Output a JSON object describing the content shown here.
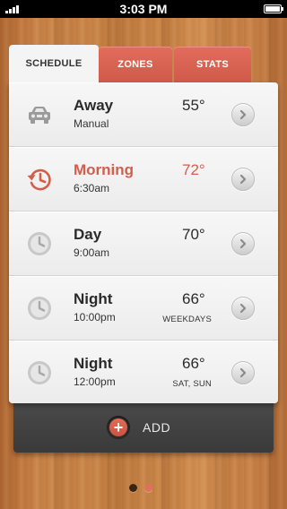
{
  "status_bar": {
    "time": "3:03 PM"
  },
  "tabs": [
    {
      "label": "SCHEDULE",
      "active": true
    },
    {
      "label": "ZONES",
      "active": false
    },
    {
      "label": "STATS",
      "active": false
    }
  ],
  "schedule": [
    {
      "name": "Away",
      "sub": "Manual",
      "temp": "55°",
      "days": "",
      "icon": "car-icon",
      "active": false
    },
    {
      "name": "Morning",
      "sub": "6:30am",
      "temp": "72°",
      "days": "",
      "icon": "history-clock-icon",
      "active": true
    },
    {
      "name": "Day",
      "sub": "9:00am",
      "temp": "70°",
      "days": "",
      "icon": "clock-icon",
      "active": false
    },
    {
      "name": "Night",
      "sub": "10:00pm",
      "temp": "66°",
      "days": "WEEKDAYS",
      "icon": "clock-icon",
      "active": false
    },
    {
      "name": "Night",
      "sub": "12:00pm",
      "temp": "66°",
      "days": "SAT, SUN",
      "icon": "clock-icon",
      "active": false
    }
  ],
  "add": {
    "label": "ADD",
    "icon": "plus-icon"
  },
  "pager": {
    "current": 1,
    "total": 2
  },
  "colors": {
    "accent": "#d45d4b",
    "panel": "#424242",
    "card": "#f2f2f2"
  }
}
